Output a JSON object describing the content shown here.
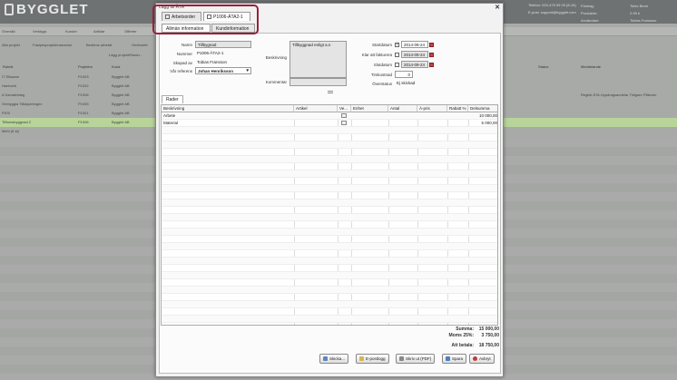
{
  "app": {
    "logo": "BYGGLET",
    "contact_phone": "Telefon: 020-475 09 00 (8-16)",
    "contact_email": "E-post: support@bygglet.com",
    "right_labels": [
      "Företag:",
      "Produktnr:",
      "Användare:"
    ],
    "right_values": [
      "Totex Bemi",
      "2.99 b",
      "Tobias Fransson"
    ]
  },
  "background": {
    "toolbar": [
      "Översikt",
      "Verktygs",
      "Kunder",
      "Artiklar",
      "Offerter"
    ],
    "filters": [
      "Alla projekt",
      "Fastprisprojekt/ramavtal",
      "Bedöms arbetat",
      "Ombrulett",
      "Lägg projekt/Rader..."
    ],
    "headers": [
      "Rubrik",
      "Projektnr",
      "Kund",
      "Ort",
      "Startdatum",
      "Slutdatum",
      "Status",
      "Meddelande"
    ],
    "rows": [
      {
        "name": "IT Elkaane",
        "nr": "P1003",
        "kund": "Bygglet AB"
      },
      {
        "name": "Hantverk",
        "nr": "P1002",
        "kund": "Bygglet AB"
      },
      {
        "name": "A Samarbetsg",
        "nr": "P1006",
        "kund": "Bygglet AB",
        "note": "Reglist ÄTA Uppdragsandelar  Tidigare Påteckn"
      },
      {
        "name": "Ombyggla Tillskjutningen",
        "nr": "P1005",
        "kund": "Bygglet AB"
      },
      {
        "name": "PSSI",
        "nr": "P1001",
        "kund": "Bygglet AB"
      },
      {
        "name": "Tilllomsbyggnad 2",
        "nr": "P1006",
        "kund": "Bygglet AB",
        "selected": true
      },
      {
        "name": "Mehl (6 st)",
        "nr": "",
        "kund": ""
      }
    ]
  },
  "dialog": {
    "title": "Lägg till ÄTA",
    "tabs": [
      {
        "label": "Arbetsorder",
        "active": false
      },
      {
        "label": "P1006-ÄTA2-1",
        "active": true
      }
    ],
    "subtabs": [
      {
        "label": "Allmän information",
        "active": true
      },
      {
        "label": "Kundinformation",
        "active": false
      }
    ],
    "form": {
      "namn_label": "Namn",
      "namn_value": "Tillbygnad",
      "nummer_label": "Nummer",
      "nummer_value": "P1006-ÄTA2-1",
      "skapad_label": "Skapad av",
      "skapad_value": "Tobias Fransson",
      "ref_label": "Vår referens",
      "ref_value": "Johan Henriksson",
      "beskrivning_label": "Beskrivning",
      "beskrivning_value": "Tillbyggnad enligt a.n",
      "kommentar_label": "Kommentar",
      "kommentar_value": "",
      "startdatum_label": "Startdatum",
      "startdatum_value": "2014-09-24",
      "klar_label": "Klar att fakturera",
      "klar_value": "2014-09-24",
      "slut_label": "Slutdatum",
      "slut_value": "2014-09-24",
      "tim_label": "Timkostnad",
      "tim_value": "0",
      "status_label": "Överstatus",
      "status_value": "Ej skickad"
    },
    "rows_tab": "Rader",
    "grid_headers": [
      "Beskrivning",
      "Artikel",
      "Ve...",
      "Enhet",
      "Antal",
      "Á-pris",
      "Rabatt %",
      "Delsumma"
    ],
    "grid_rows": [
      {
        "beskrivning": "Arbete",
        "delsumma": "10 000,00"
      },
      {
        "beskrivning": "Material",
        "delsumma": "5 000,00"
      }
    ],
    "summary": {
      "summa_label": "Summa:",
      "summa_value": "15 000,00",
      "moms_label": "Moms 25%:",
      "moms_value": "3 750,00",
      "total_label": "Att betala:",
      "total_value": "18 750,00"
    },
    "buttons": {
      "skicka": "Skicka...",
      "epost": "E-postlogg",
      "skriv": "Skriv ut (PDF)",
      "spara": "Spara",
      "avbryt": "Avbryt"
    }
  }
}
